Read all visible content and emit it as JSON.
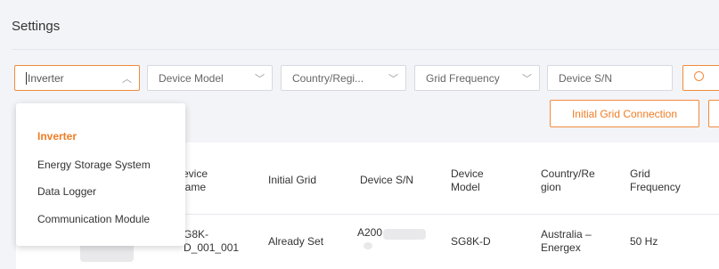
{
  "header": {
    "title": "Settings"
  },
  "filters": {
    "device_type": {
      "value": "Inverter"
    },
    "device_model": {
      "placeholder": "Device Model"
    },
    "country_region": {
      "placeholder": "Country/Regi..."
    },
    "grid_frequency": {
      "placeholder": "Grid Frequency"
    },
    "device_sn": {
      "placeholder": "Device S/N"
    }
  },
  "actions": {
    "initial_grid_connection": "Initial Grid Connection"
  },
  "dropdown": {
    "options": [
      "Inverter",
      "Energy Storage System",
      "Data Logger",
      "Communication Module"
    ],
    "selected_index": 0
  },
  "table": {
    "columns": [
      "evice\nlame",
      "Initial Grid",
      "Device S/N",
      "Device\nModel",
      "Country/Re\ngion",
      "Grid\nFrequency"
    ],
    "rows": [
      {
        "device_name": "G8K-\nD_001_001",
        "initial_grid": "Already Set",
        "device_sn": "A200",
        "device_model": "SG8K-D",
        "country_region": "Australia –\nEnergex",
        "grid_frequency": "50 Hz"
      }
    ]
  },
  "colors": {
    "accent": "#f07c24",
    "border": "#d6d9de",
    "background": "#f3f4f8"
  }
}
